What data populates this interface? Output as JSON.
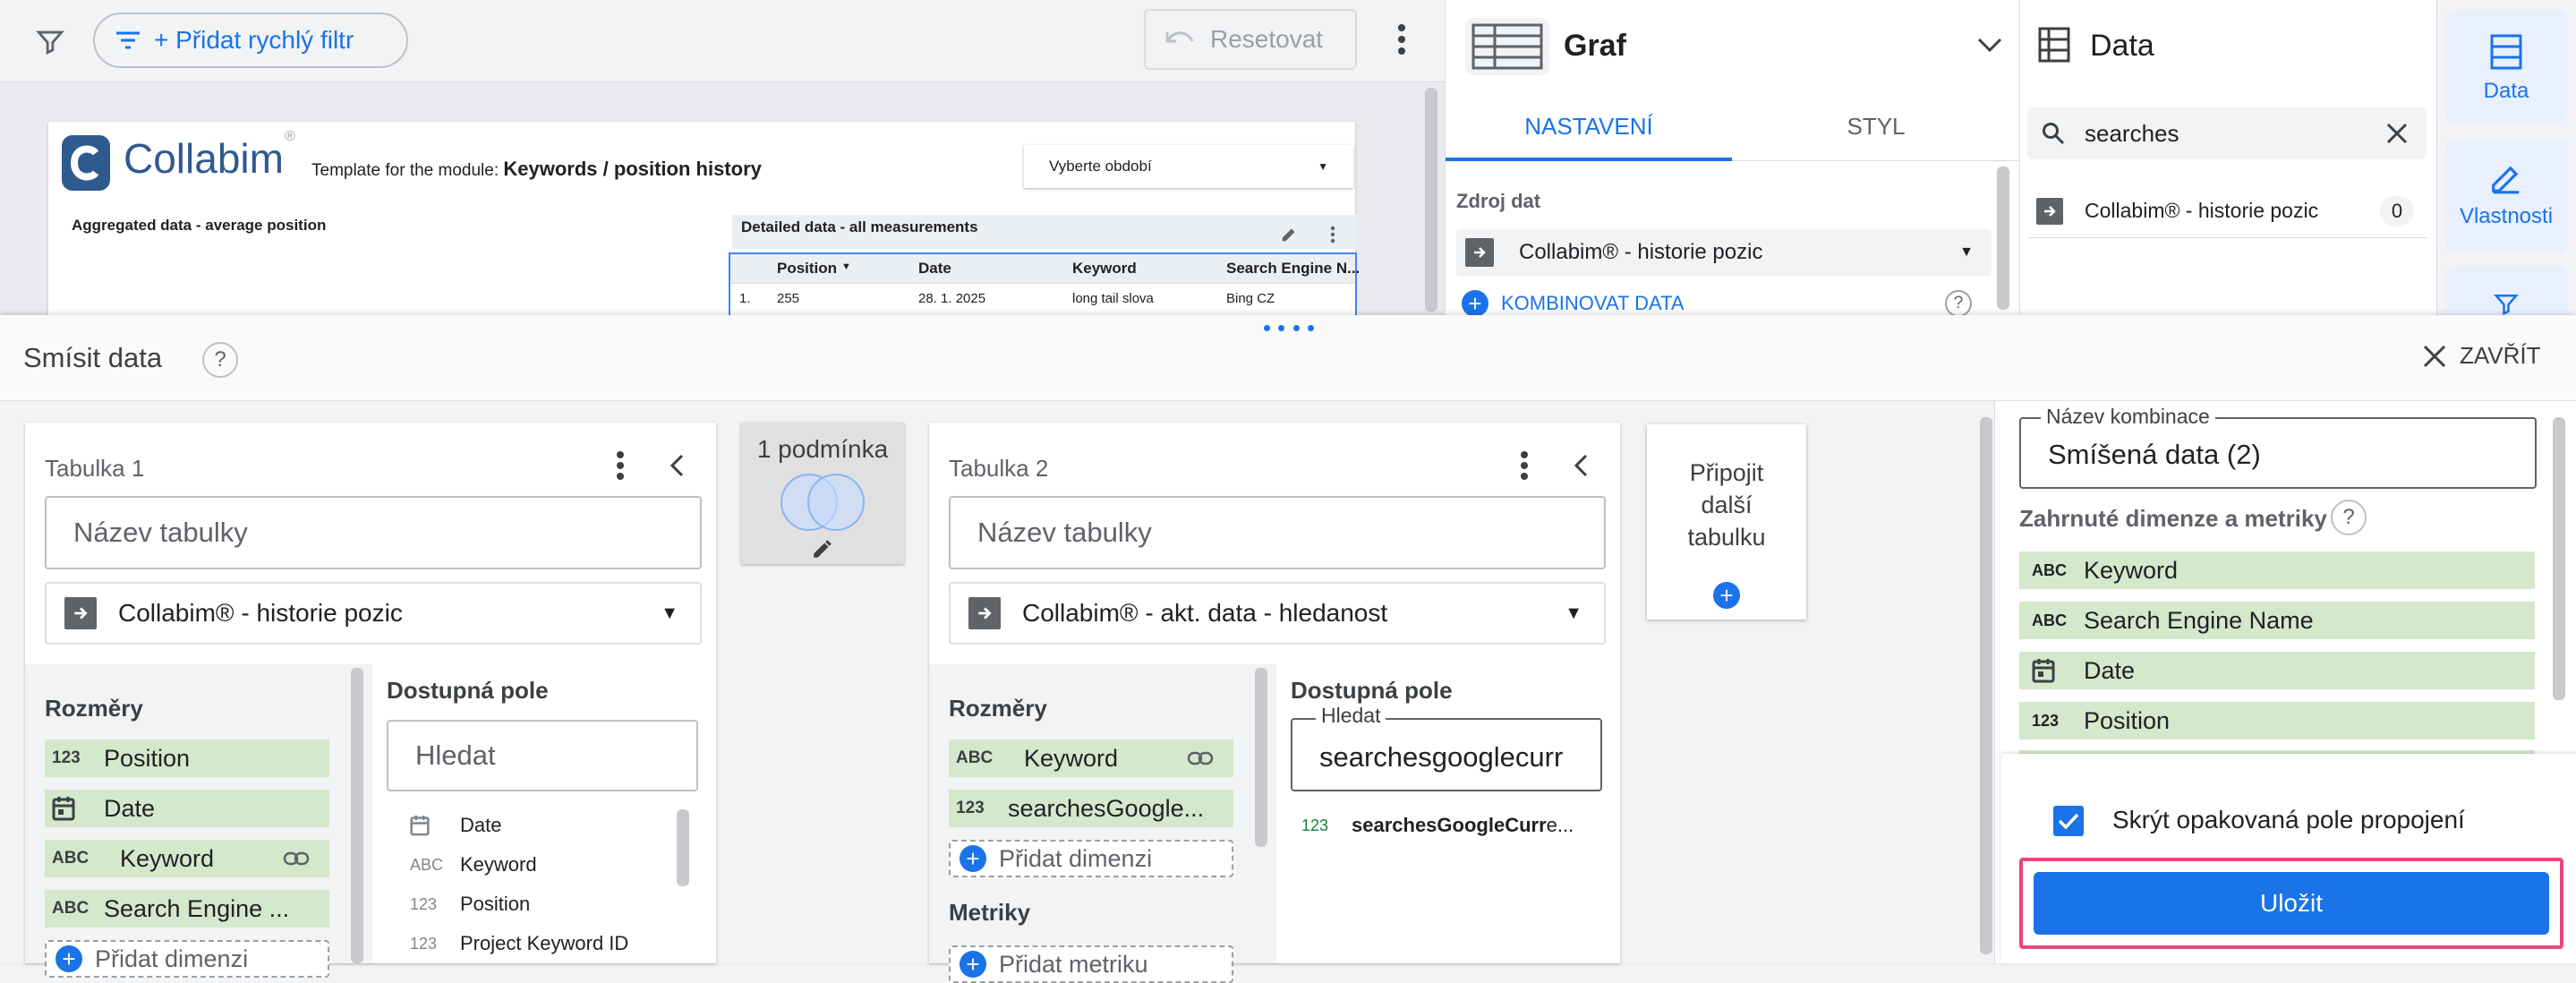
{
  "toolbar": {
    "add_filter_label": "+ Přidat rychlý filtr",
    "reset_label": "Resetovat"
  },
  "report": {
    "logo_text": "Collabim",
    "template_prefix": "Template for the module: ",
    "template_name": "Keywords / position history",
    "period_select": "Vyberte období",
    "aggregated_title": "Aggregated data - average position",
    "detailed_title": "Detailed data - all measurements",
    "table_headers": [
      "Position",
      "Date",
      "Keyword",
      "Search Engine N..."
    ],
    "table_row": [
      "1.",
      "255",
      "28. 1. 2025",
      "long tail slova",
      "Bing CZ"
    ]
  },
  "chart_panel": {
    "title": "Graf",
    "tabs": [
      "NASTAVENÍ",
      "STYL"
    ],
    "source_label": "Zdroj dat",
    "source_value": "Collabim® - historie pozic",
    "blend_link": "KOMBINOVAT DATA",
    "help": "?"
  },
  "data_panel": {
    "title": "Data",
    "search_value": "searches",
    "result_name": "Collabim® - historie pozic",
    "result_count": "0"
  },
  "rail": {
    "data_label": "Data",
    "props_label": "Vlastnosti"
  },
  "blend": {
    "title": "Smísit data",
    "help": "?",
    "close_label": "ZAVŘÍT",
    "join": {
      "label": "1 podmínka"
    },
    "add_table": "Připojit další tabulku",
    "table1": {
      "title": "Tabulka 1",
      "name_placeholder": "Název tabulky",
      "source": "Collabim® - historie pozic",
      "dims_label": "Rozměry",
      "dims": [
        {
          "type": "123",
          "name": "Position"
        },
        {
          "type": "date",
          "name": "Date"
        },
        {
          "type": "ABC",
          "name": "Keyword"
        },
        {
          "type": "ABC",
          "name": "Search Engine ..."
        }
      ],
      "add_dim": "Přidat dimenzi",
      "avail_label": "Dostupná pole",
      "search_placeholder": "Hledat",
      "avail_fields": [
        {
          "type": "date",
          "name": "Date"
        },
        {
          "type": "ABC",
          "name": "Keyword"
        },
        {
          "type": "123",
          "name": "Position"
        },
        {
          "type": "123",
          "name": "Project Keyword ID"
        }
      ]
    },
    "table2": {
      "title": "Tabulka 2",
      "name_placeholder": "Název tabulky",
      "source": "Collabim® - akt. data - hledanost",
      "dims_label": "Rozměry",
      "dims": [
        {
          "type": "ABC",
          "name": "Keyword"
        },
        {
          "type": "123",
          "name": "searchesGoogle..."
        }
      ],
      "add_dim": "Přidat dimenzi",
      "metrics_label": "Metriky",
      "add_metric": "Přidat metriku",
      "avail_label": "Dostupná pole",
      "search_label": "Hledat",
      "search_value": "searchesgooglecurr",
      "result_type": "123",
      "result_bold": "searchesGoogleCurr",
      "result_rest": "e..."
    },
    "config": {
      "name_label": "Název kombinace",
      "name_value": "Smíšená data (2)",
      "included_label": "Zahrnuté dimenze a metriky",
      "included": [
        {
          "type": "ABC",
          "name": "Keyword"
        },
        {
          "type": "ABC",
          "name": "Search Engine Name"
        },
        {
          "type": "date",
          "name": "Date"
        },
        {
          "type": "123",
          "name": "Position"
        }
      ],
      "hide_repeat_label": "Skrýt opakovaná pole propojení",
      "save_label": "Uložit"
    }
  }
}
